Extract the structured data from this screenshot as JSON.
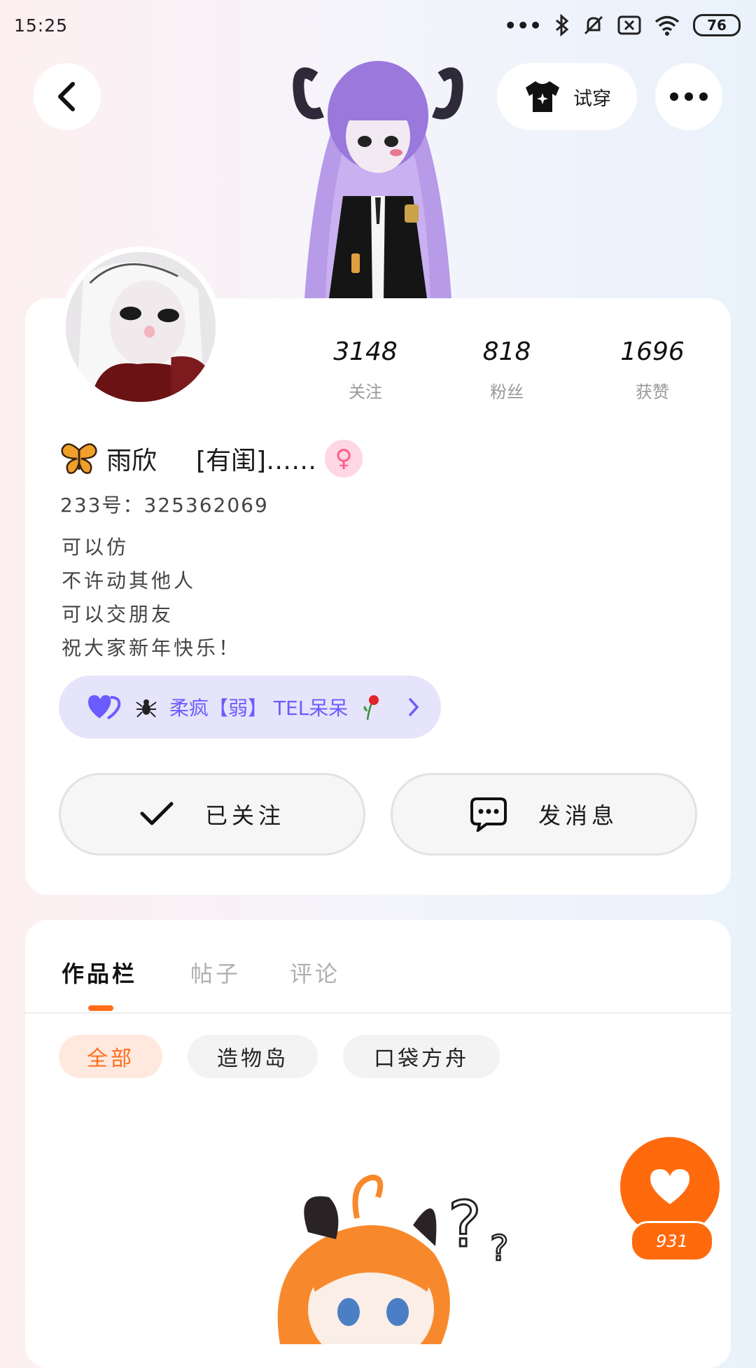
{
  "status_bar": {
    "time": "15:25",
    "battery": "76",
    "icons": [
      "more-dots-icon",
      "bluetooth-icon",
      "mute-bell-icon",
      "sim-off-icon",
      "wifi-icon",
      "battery-icon"
    ]
  },
  "header": {
    "back_icon": "chevron-left-icon",
    "tryon_label": "试穿",
    "tryon_icon": "tshirt-icon",
    "more_icon": "more-dots-icon"
  },
  "profile": {
    "stats": [
      {
        "value": "3148",
        "label": "关注"
      },
      {
        "value": "818",
        "label": "粉丝"
      },
      {
        "value": "1696",
        "label": "获赞"
      }
    ],
    "name": "雨欣",
    "name_suffix": "[有闺]……",
    "gender_symbol": "♀",
    "uid": "233号：325362069",
    "bio": [
      "可以仿",
      "不许动其他人",
      "可以交朋友",
      "祝大家新年快乐！"
    ],
    "medal_text": "柔疯【弱】 TEL呆呆",
    "follow_label": "已关注",
    "message_label": "发消息"
  },
  "tabs": [
    {
      "label": "作品栏",
      "active": true
    },
    {
      "label": "帖子",
      "active": false
    },
    {
      "label": "评论",
      "active": false
    }
  ],
  "filters": [
    {
      "label": "全部",
      "active": true
    },
    {
      "label": "造物岛",
      "active": false
    },
    {
      "label": "口袋方舟",
      "active": false
    }
  ],
  "like": {
    "count": "931"
  },
  "colors": {
    "accent": "#ff6a0d",
    "medal_bg": "#e6e4fb",
    "medal_text": "#6b5cff",
    "gender": "#ff5b8c"
  }
}
